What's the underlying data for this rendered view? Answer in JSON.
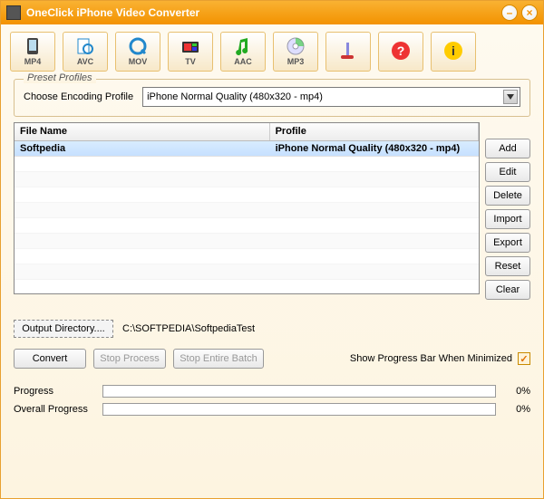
{
  "window": {
    "title": "OneClick iPhone Video Converter"
  },
  "toolbar": [
    {
      "name": "mp4-button",
      "label": "MP4"
    },
    {
      "name": "avc-button",
      "label": "AVC"
    },
    {
      "name": "mov-button",
      "label": "MOV"
    },
    {
      "name": "tv-button",
      "label": "TV"
    },
    {
      "name": "aac-button",
      "label": "AAC"
    },
    {
      "name": "mp3-button",
      "label": "MP3"
    }
  ],
  "preset": {
    "legend": "Preset Profiles",
    "label": "Choose Encoding Profile",
    "selected": "iPhone Normal Quality (480x320 - mp4)"
  },
  "columns": {
    "name": "File Name",
    "profile": "Profile"
  },
  "rows": [
    {
      "name": "Softpedia",
      "profile": "iPhone Normal Quality (480x320 - mp4)"
    }
  ],
  "sideButtons": {
    "add": "Add",
    "edit": "Edit",
    "delete": "Delete",
    "import": "Import",
    "export": "Export",
    "reset": "Reset",
    "clear": "Clear"
  },
  "output": {
    "button": "Output Directory....",
    "path": "C:\\SOFTPEDIA\\SoftpediaTest"
  },
  "actions": {
    "convert": "Convert",
    "stopProcess": "Stop Process",
    "stopBatch": "Stop Entire Batch",
    "showProgressLabel": "Show Progress Bar When Minimized",
    "showProgressChecked": "✓"
  },
  "progress": {
    "label1": "Progress",
    "val1": "0%",
    "label2": "Overall Progress",
    "val2": "0%"
  }
}
